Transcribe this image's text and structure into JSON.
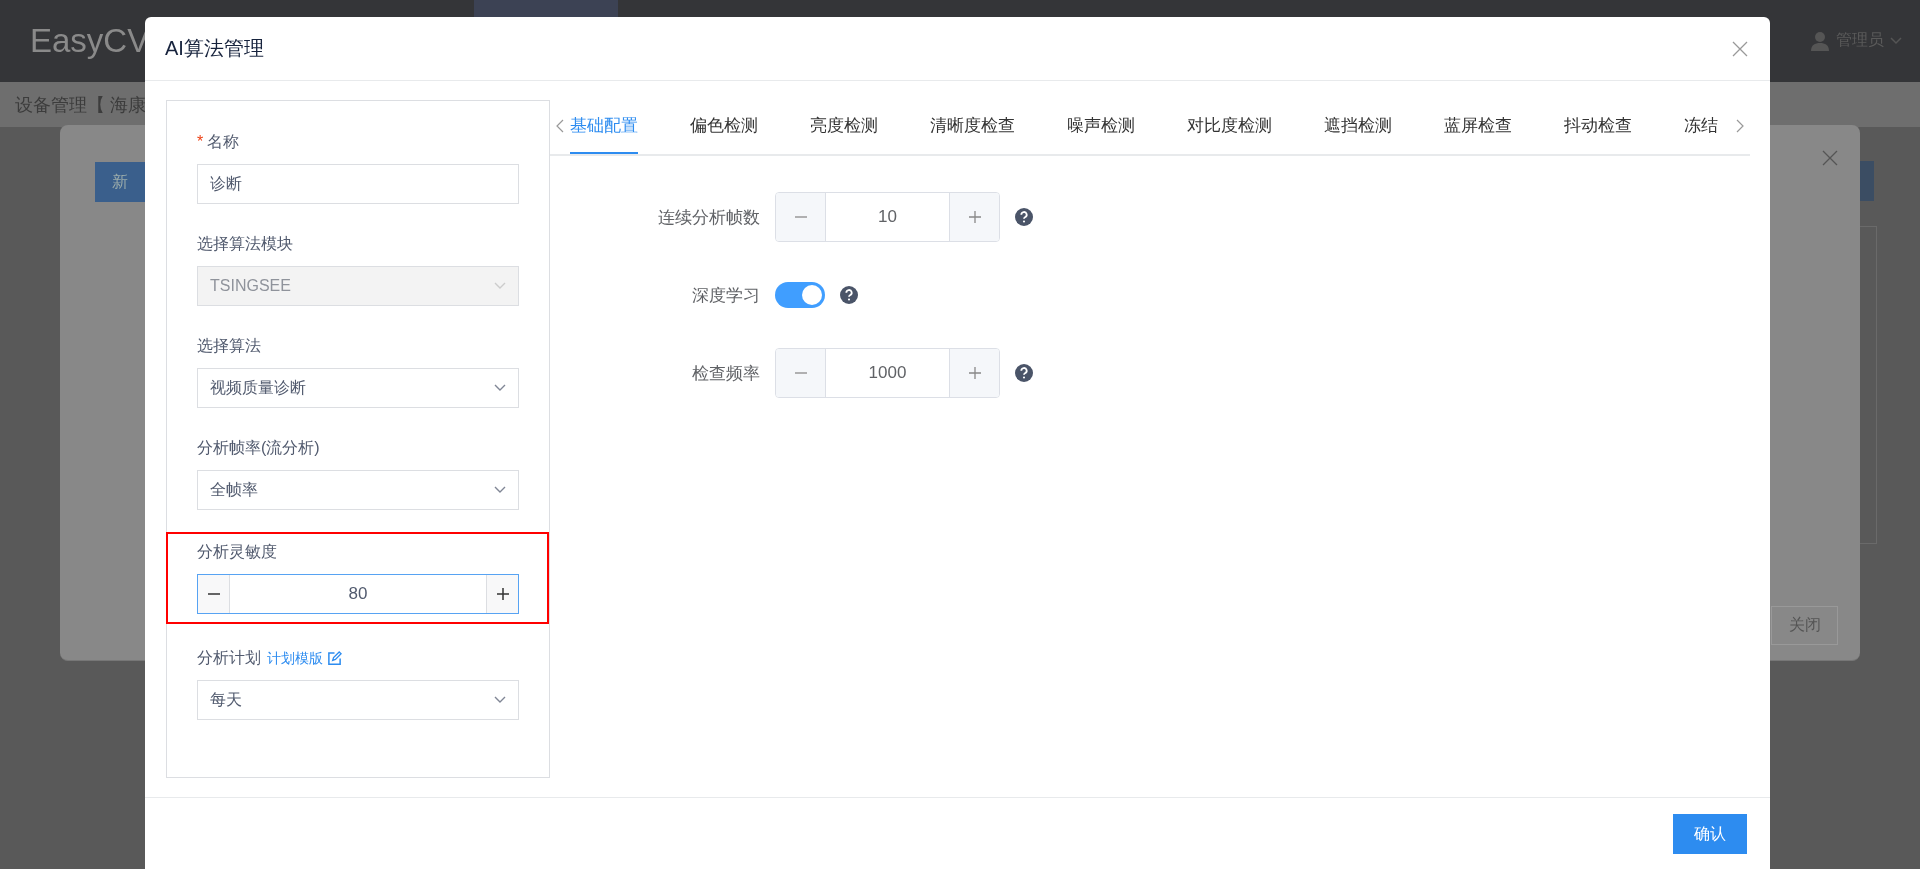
{
  "app": {
    "logo": "EasyCV",
    "user": "管理员",
    "breadcrumb": "设备管理【 海康"
  },
  "back_dialog": {
    "add_button": "新",
    "close_button": "关闭"
  },
  "dialog": {
    "title": "AI算法管理",
    "form": [
      {
        "kind": "text",
        "label": "名称",
        "required": true,
        "required_mark": "*",
        "value": "诊断",
        "highlighted": false
      },
      {
        "kind": "select",
        "label": "选择算法模块",
        "required": false,
        "value": "TSINGSEE",
        "disabled": true,
        "highlighted": false
      },
      {
        "kind": "select",
        "label": "选择算法",
        "required": false,
        "value": "视频质量诊断",
        "disabled": false,
        "highlighted": false
      },
      {
        "kind": "select",
        "label": "分析帧率(流分析)",
        "required": false,
        "value": "全帧率",
        "disabled": false,
        "highlighted": false
      },
      {
        "kind": "number",
        "label": "分析灵敏度",
        "required": false,
        "value": "80",
        "highlighted": true
      },
      {
        "kind": "select",
        "label": "分析计划",
        "link": "计划模版",
        "required": false,
        "value": "每天",
        "disabled": false,
        "highlighted": false
      }
    ],
    "tabs": [
      {
        "label": "基础配置",
        "selected": true
      },
      {
        "label": "偏色检测",
        "selected": false
      },
      {
        "label": "亮度检测",
        "selected": false
      },
      {
        "label": "清晰度检查",
        "selected": false
      },
      {
        "label": "噪声检测",
        "selected": false
      },
      {
        "label": "对比度检测",
        "selected": false
      },
      {
        "label": "遮挡检测",
        "selected": false
      },
      {
        "label": "蓝屏检查",
        "selected": false
      },
      {
        "label": "抖动检查",
        "selected": false
      },
      {
        "label": "冻结",
        "selected": false
      }
    ],
    "settings": [
      {
        "kind": "number",
        "label": "连续分析帧数",
        "value": "10"
      },
      {
        "kind": "switch",
        "label": "深度学习",
        "on": true
      },
      {
        "kind": "number",
        "label": "检查频率",
        "value": "1000"
      }
    ],
    "confirm_button": "确认"
  }
}
